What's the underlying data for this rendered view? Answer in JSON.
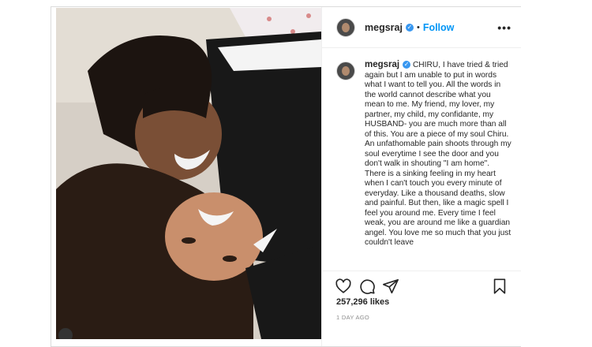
{
  "header": {
    "username": "megsraj",
    "separator": "•",
    "follow_label": "Follow",
    "more_label": "•••"
  },
  "caption": {
    "username": "megsraj",
    "paragraphs": [
      "CHIRU, I have tried & tried again but I am unable to put in words what I want to tell you. All the words in the world cannot describe what you mean to me. My friend, my lover, my partner, my child, my confidante, my HUSBAND- you are much more than all of this. You are a piece of my soul Chiru.",
      "An unfathomable pain shoots through my soul everytime I see the door and you don't walk in shouting \"I am home\". There is a sinking feeling in my heart when I can't touch you every minute of everyday. Like a thousand deaths, slow and painful. But then, like a magic spell I feel you around me. Every time I feel weak, you are around me like a guardian angel. You love me so much that you just couldn't leave"
    ]
  },
  "stats": {
    "likes": "257,296 likes",
    "time": "1 DAY AGO"
  },
  "icons": {
    "like": "heart-icon",
    "comment": "comment-icon",
    "share": "paper-plane-icon",
    "save": "bookmark-icon"
  },
  "colors": {
    "accent": "#0095f6",
    "verified": "#3897f0"
  }
}
